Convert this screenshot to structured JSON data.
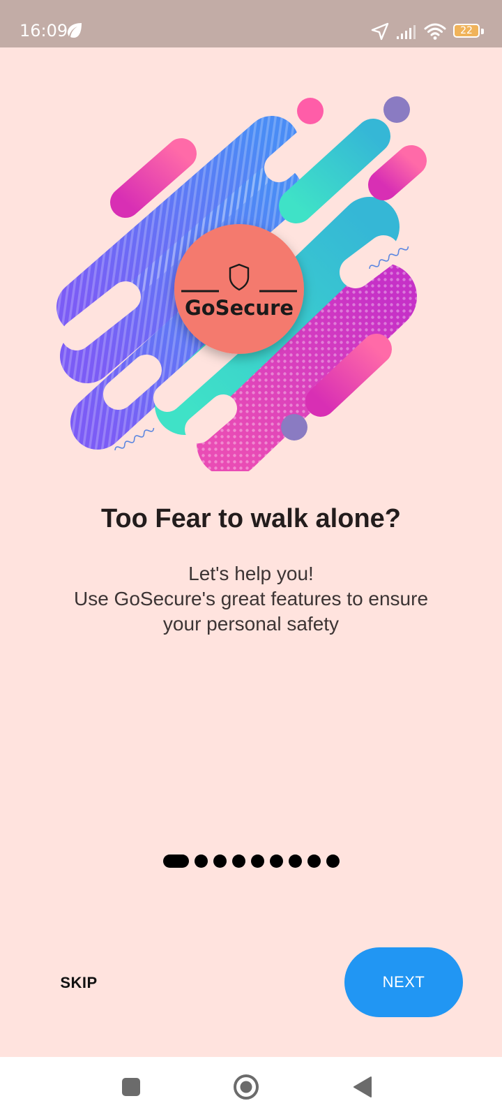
{
  "status_bar": {
    "time": "16:09",
    "battery": "22",
    "icons": [
      "leaf-icon",
      "location-arrow-icon",
      "signal-icon",
      "wifi-icon",
      "battery-icon"
    ]
  },
  "illustration": {
    "logo_text": "GoSecure",
    "icon": "shield-icon"
  },
  "onboarding": {
    "title": "Too Fear to walk alone?",
    "subtitle_lines": [
      "Let's help you!",
      "Use GoSecure's great features to ensure",
      "your personal safety"
    ],
    "page_count": 9,
    "current_page": 1
  },
  "buttons": {
    "skip_label": "SKIP",
    "next_label": "NEXT"
  },
  "colors": {
    "background": "#FFE3DE",
    "status_bar": "#C2ACA6",
    "accent": "#2196F3",
    "logo_circle": "#F47A6E"
  },
  "nav_bar": {
    "icons": [
      "recent-apps-icon",
      "home-icon",
      "back-icon"
    ]
  }
}
